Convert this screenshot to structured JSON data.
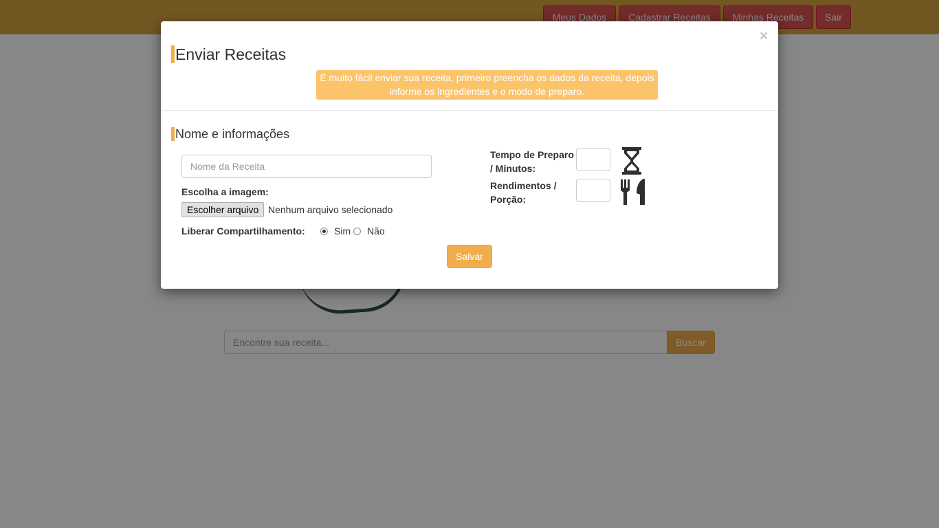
{
  "navbar": {
    "items": [
      {
        "label": "Meus Dados"
      },
      {
        "label": "Cadastrar Receitas"
      },
      {
        "label": "Minhas Receitas"
      },
      {
        "label": "Sair"
      }
    ]
  },
  "search": {
    "placeholder": "Encontre sua receita...",
    "button_label": "Buscar"
  },
  "modal": {
    "close_label": "×",
    "title": "Enviar Receitas",
    "banner_line1": "É muito fácil enviar sua receita, primeiro preencha os dados da receita, depois",
    "banner_line2": "informe os ingredientes e o modo de preparo.",
    "section_title": "Nome e informações",
    "name_placeholder": "Nome da Receita",
    "image_label": "Escolha a imagem:",
    "file_button_label": "Escolher arquivo",
    "file_status": "Nenhum arquivo selecionado",
    "share_label": "Liberar Compartilhamento:",
    "share_options": [
      {
        "label": "Sim",
        "selected": true
      },
      {
        "label": "Não",
        "selected": false
      }
    ],
    "prep_time_label_line1": "Tempo de Preparo",
    "prep_time_label_line2": "/ Minutos:",
    "prep_time_value": "",
    "yield_label_line1": "Rendimentos /",
    "yield_label_line2": "Porção:",
    "yield_value": "",
    "save_label": "Salvar"
  },
  "icons": {
    "prep_time": "hourglass-icon",
    "yield": "fork-knife-icon"
  },
  "colors": {
    "navbar": "#d9a441",
    "nav_button": "#d9534f",
    "accent": "#f0ad4e",
    "banner": "#fcc46a"
  }
}
